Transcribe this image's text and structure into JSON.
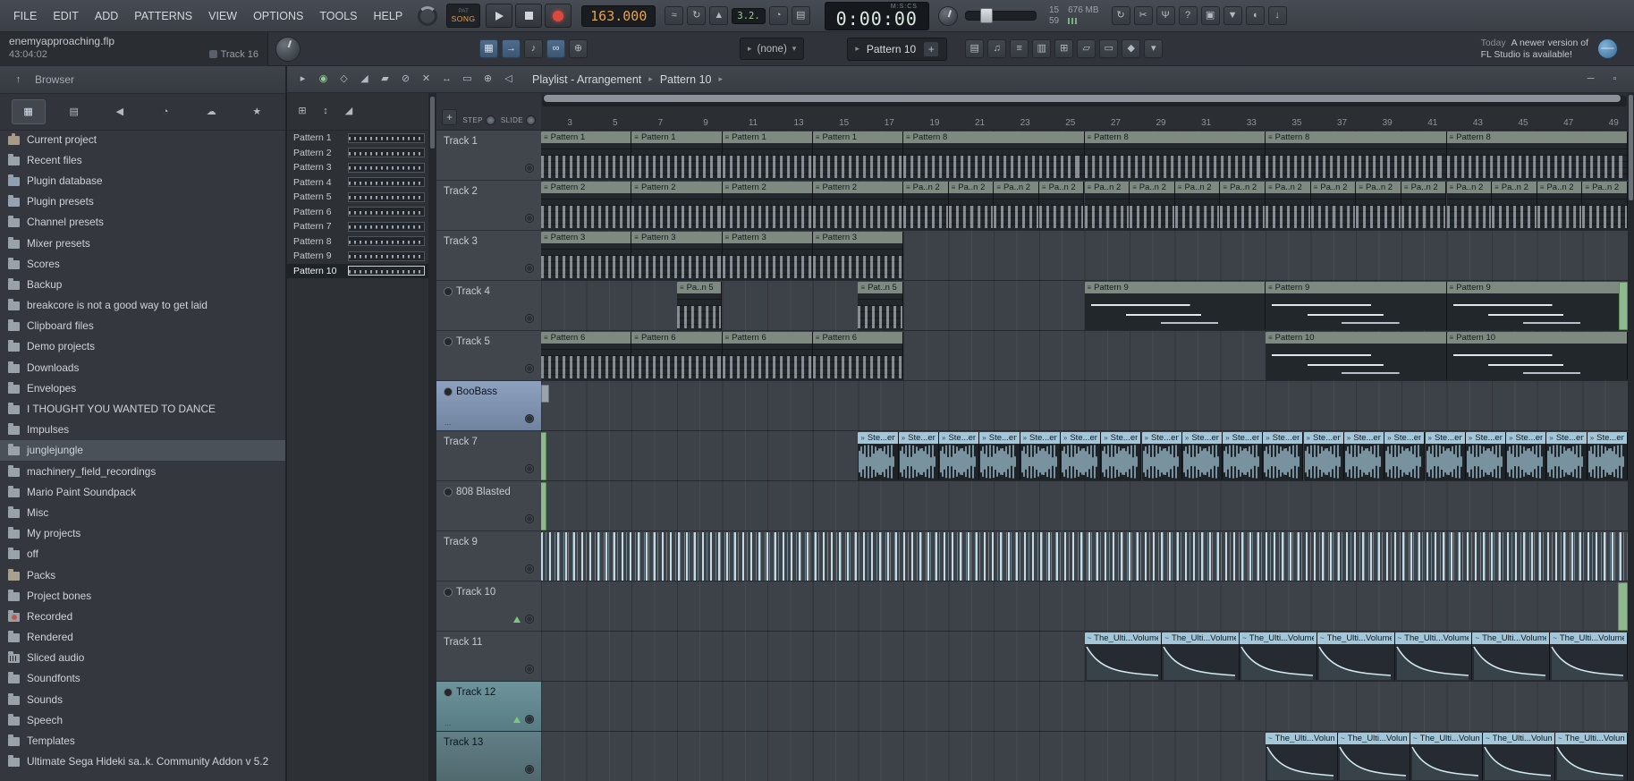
{
  "menubar": {
    "items": [
      "FILE",
      "EDIT",
      "ADD",
      "PATTERNS",
      "VIEW",
      "OPTIONS",
      "TOOLS",
      "HELP"
    ]
  },
  "transport": {
    "mode_top": "PAT",
    "mode_label": "SONG",
    "tempo": "163.000",
    "aux": "3.2.",
    "time": "0:00:00",
    "time_units": "M:S:CS",
    "stat_count": "15",
    "stat_memory": "676 MB",
    "stat_cpu": "59"
  },
  "project_panel": {
    "filename": "enemyapproaching.flp",
    "elapsed": "43:04:02",
    "track_hint": "Track 16"
  },
  "toolbar": {
    "picker_value": "(none)",
    "pattern_value": "Pattern 10",
    "pattern_add": "+",
    "notification_day": "Today",
    "notification_line1": "A newer version of",
    "notification_line2": "FL Studio is available!"
  },
  "browser": {
    "title": "Browser",
    "items": [
      {
        "label": "Current project",
        "icon": "case"
      },
      {
        "label": "Recent files",
        "icon": "folder"
      },
      {
        "label": "Plugin database",
        "icon": "db"
      },
      {
        "label": "Plugin presets",
        "icon": "plug"
      },
      {
        "label": "Channel presets",
        "icon": "folder"
      },
      {
        "label": "Mixer presets",
        "icon": "folder"
      },
      {
        "label": "Scores",
        "icon": "folder"
      },
      {
        "label": "Backup",
        "icon": "folder"
      },
      {
        "label": "breakcore is not a good way to get laid",
        "icon": "folder"
      },
      {
        "label": "Clipboard files",
        "icon": "folder"
      },
      {
        "label": "Demo projects",
        "icon": "folder"
      },
      {
        "label": "Downloads",
        "icon": "folder"
      },
      {
        "label": "Envelopes",
        "icon": "folder"
      },
      {
        "label": "I THOUGHT YOU WANTED TO DANCE",
        "icon": "folder"
      },
      {
        "label": "Impulses",
        "icon": "folder"
      },
      {
        "label": "junglejungle",
        "icon": "folder",
        "selected": true
      },
      {
        "label": "machinery_field_recordings",
        "icon": "folder"
      },
      {
        "label": "Mario Paint Soundpack",
        "icon": "folder"
      },
      {
        "label": "Misc",
        "icon": "folder"
      },
      {
        "label": "My projects",
        "icon": "folder"
      },
      {
        "label": "off",
        "icon": "folder"
      },
      {
        "label": "Packs",
        "icon": "pack"
      },
      {
        "label": "Project bones",
        "icon": "folder"
      },
      {
        "label": "Recorded",
        "icon": "rec"
      },
      {
        "label": "Rendered",
        "icon": "folder"
      },
      {
        "label": "Sliced audio",
        "icon": "sliced"
      },
      {
        "label": "Soundfonts",
        "icon": "folder"
      },
      {
        "label": "Sounds",
        "icon": "folder"
      },
      {
        "label": "Speech",
        "icon": "folder"
      },
      {
        "label": "Templates",
        "icon": "folder"
      },
      {
        "label": "Ultimate Sega Hideki sa..k. Community Addon v 5.2",
        "icon": "folder"
      }
    ]
  },
  "pattern_list": {
    "items": [
      "Pattern 1",
      "Pattern 2",
      "Pattern 3",
      "Pattern 4",
      "Pattern 5",
      "Pattern 6",
      "Pattern 7",
      "Pattern 8",
      "Pattern 9",
      "Pattern 10"
    ],
    "selected_index": 9
  },
  "playlist": {
    "title": "Playlist - Arrangement",
    "crumb": "Pattern 10",
    "add_label": "+",
    "step_label": "STEP",
    "slide_label": "SLIDE",
    "first_bar": 2,
    "ruler_labels": [
      3,
      5,
      7,
      9,
      11,
      13,
      15,
      17,
      19,
      21,
      23,
      25,
      27,
      29,
      31,
      33,
      35,
      37,
      39,
      41,
      43,
      45,
      47,
      49
    ],
    "tracks": [
      {
        "name": "Track 1",
        "clips": [
          {
            "t": "p",
            "label": "Pattern 1",
            "s": 2,
            "l": 4
          },
          {
            "t": "p",
            "label": "Pattern 1",
            "s": 6,
            "l": 4
          },
          {
            "t": "p",
            "label": "Pattern 1",
            "s": 10,
            "l": 4
          },
          {
            "t": "p",
            "label": "Pattern 1",
            "s": 14,
            "l": 4
          },
          {
            "t": "p",
            "label": "Pattern 8",
            "s": 18,
            "l": 8
          },
          {
            "t": "p",
            "label": "Pattern 8",
            "s": 26,
            "l": 8
          },
          {
            "t": "p",
            "label": "Pattern 8",
            "s": 34,
            "l": 8
          },
          {
            "t": "p",
            "label": "Pattern 8",
            "s": 42,
            "l": 8
          }
        ]
      },
      {
        "name": "Track 2",
        "clips": [
          {
            "t": "p",
            "label": "Pattern 2",
            "s": 2,
            "l": 4
          },
          {
            "t": "p",
            "label": "Pattern 2",
            "s": 6,
            "l": 4
          },
          {
            "t": "p",
            "label": "Pattern 2",
            "s": 10,
            "l": 4
          },
          {
            "t": "p",
            "label": "Pattern 2",
            "s": 14,
            "l": 4
          },
          {
            "t": "p",
            "label": "Pa..n 2",
            "s": 18,
            "l": 2
          },
          {
            "t": "p",
            "label": "Pa..n 2",
            "s": 20,
            "l": 2
          },
          {
            "t": "p",
            "label": "Pa..n 2",
            "s": 22,
            "l": 2
          },
          {
            "t": "p",
            "label": "Pa..n 2",
            "s": 24,
            "l": 2
          },
          {
            "t": "p",
            "label": "Pa..n 2",
            "s": 26,
            "l": 2
          },
          {
            "t": "p",
            "label": "Pa..n 2",
            "s": 28,
            "l": 2
          },
          {
            "t": "p",
            "label": "Pa..n 2",
            "s": 30,
            "l": 2
          },
          {
            "t": "p",
            "label": "Pa..n 2",
            "s": 32,
            "l": 2
          },
          {
            "t": "p",
            "label": "Pa..n 2",
            "s": 34,
            "l": 2
          },
          {
            "t": "p",
            "label": "Pa..n 2",
            "s": 36,
            "l": 2
          },
          {
            "t": "p",
            "label": "Pa..n 2",
            "s": 38,
            "l": 2
          },
          {
            "t": "p",
            "label": "Pa..n 2",
            "s": 40,
            "l": 2
          },
          {
            "t": "p",
            "label": "Pa..n 2",
            "s": 42,
            "l": 2
          },
          {
            "t": "p",
            "label": "Pa..n 2",
            "s": 44,
            "l": 2
          },
          {
            "t": "p",
            "label": "Pa..n 2",
            "s": 46,
            "l": 2
          },
          {
            "t": "p",
            "label": "Pa..n 2",
            "s": 48,
            "l": 2
          }
        ]
      },
      {
        "name": "Track 3",
        "clips": [
          {
            "t": "p",
            "label": "Pattern 3",
            "s": 2,
            "l": 4
          },
          {
            "t": "p",
            "label": "Pattern 3",
            "s": 6,
            "l": 4
          },
          {
            "t": "p",
            "label": "Pattern 3",
            "s": 10,
            "l": 4
          },
          {
            "t": "p",
            "label": "Pattern 3",
            "s": 14,
            "l": 4
          }
        ]
      },
      {
        "name": "Track 4",
        "muted_icon": true,
        "clips": [
          {
            "t": "p",
            "label": "Pa..n 5",
            "s": 8,
            "l": 2
          },
          {
            "t": "p",
            "label": "Pat..n 5",
            "s": 16,
            "l": 2
          },
          {
            "t": "pb",
            "label": "Pattern 9",
            "s": 26,
            "l": 8
          },
          {
            "t": "pb",
            "label": "Pattern 9",
            "s": 34,
            "l": 8
          },
          {
            "t": "pb",
            "label": "Pattern 9",
            "s": 42,
            "l": 8
          },
          {
            "t": "sg",
            "s": 49.6,
            "l": 0.4
          }
        ]
      },
      {
        "name": "Track 5",
        "muted_icon": true,
        "clips": [
          {
            "t": "p",
            "label": "Pattern 6",
            "s": 2,
            "l": 4
          },
          {
            "t": "p",
            "label": "Pattern 6",
            "s": 6,
            "l": 4
          },
          {
            "t": "p",
            "label": "Pattern 6",
            "s": 10,
            "l": 4
          },
          {
            "t": "p",
            "label": "Pattern 6",
            "s": 14,
            "l": 4
          },
          {
            "t": "pb",
            "label": "Pattern 10",
            "s": 34,
            "l": 8
          },
          {
            "t": "pb",
            "label": "Pattern 10",
            "s": 42,
            "l": 8
          }
        ]
      },
      {
        "name": "BooBass",
        "muted_icon": true,
        "sel": "blue",
        "sub": "...",
        "clips": [
          {
            "t": "sb",
            "s": 2,
            "l": 0.35
          }
        ]
      },
      {
        "name": "Track 7",
        "clips": [
          {
            "t": "sg",
            "s": 1.85,
            "l": 0.4
          },
          {
            "t": "a",
            "label": "Ste...en",
            "s": 16,
            "l": 1.79
          },
          {
            "t": "a",
            "label": "Ste...en",
            "s": 17.79,
            "l": 1.79
          },
          {
            "t": "a",
            "label": "Ste...en",
            "s": 19.58,
            "l": 1.79
          },
          {
            "t": "a",
            "label": "Ste...en",
            "s": 21.37,
            "l": 1.79
          },
          {
            "t": "a",
            "label": "Ste...en",
            "s": 23.16,
            "l": 1.79
          },
          {
            "t": "a",
            "label": "Ste...en",
            "s": 24.95,
            "l": 1.79
          },
          {
            "t": "a",
            "label": "Ste...en",
            "s": 26.74,
            "l": 1.79
          },
          {
            "t": "a",
            "label": "Ste...en",
            "s": 28.53,
            "l": 1.79
          },
          {
            "t": "a",
            "label": "Ste...en",
            "s": 30.32,
            "l": 1.79
          },
          {
            "t": "a",
            "label": "Ste...en",
            "s": 32.11,
            "l": 1.79
          },
          {
            "t": "a",
            "label": "Ste...en",
            "s": 33.89,
            "l": 1.79
          },
          {
            "t": "a",
            "label": "Ste...en",
            "s": 35.68,
            "l": 1.79
          },
          {
            "t": "a",
            "label": "Ste...en",
            "s": 37.47,
            "l": 1.79
          },
          {
            "t": "a",
            "label": "Ste...en",
            "s": 39.26,
            "l": 1.79
          },
          {
            "t": "a",
            "label": "Ste...en",
            "s": 41.05,
            "l": 1.79
          },
          {
            "t": "a",
            "label": "Ste...en",
            "s": 42.84,
            "l": 1.79
          },
          {
            "t": "a",
            "label": "Ste...en",
            "s": 44.63,
            "l": 1.79
          },
          {
            "t": "a",
            "label": "Ste...en",
            "s": 46.42,
            "l": 1.79
          },
          {
            "t": "a",
            "label": "Ste...en",
            "s": 48.21,
            "l": 1.79
          }
        ]
      },
      {
        "name": "808 Blasted",
        "muted_icon": true,
        "clips": [
          {
            "t": "sg",
            "s": 1.85,
            "l": 0.4
          }
        ]
      },
      {
        "name": "Track 9",
        "clips": [
          {
            "t": "sl",
            "s": 2,
            "l": 48
          }
        ]
      },
      {
        "name": "Track 10",
        "muted_icon": true,
        "arm": "green",
        "clips": [
          {
            "t": "sg",
            "s": 49.55,
            "l": 0.45
          }
        ]
      },
      {
        "name": "Track 11",
        "clips": [
          {
            "t": "au",
            "label": "The_Ulti...Volume",
            "s": 26,
            "l": 3.43
          },
          {
            "t": "au",
            "label": "The_Ulti...Volume",
            "s": 29.43,
            "l": 3.43
          },
          {
            "t": "au",
            "label": "The_Ulti...Volume",
            "s": 32.86,
            "l": 3.43
          },
          {
            "t": "au",
            "label": "The_Ulti...Volume",
            "s": 36.29,
            "l": 3.43
          },
          {
            "t": "au",
            "label": "The_Ulti...Volume",
            "s": 39.71,
            "l": 3.43
          },
          {
            "t": "au",
            "label": "The_Ulti...Volume",
            "s": 43.14,
            "l": 3.43
          },
          {
            "t": "au",
            "label": "The_Ulti...Volume",
            "s": 46.57,
            "l": 3.43
          }
        ]
      },
      {
        "name": "Track 12",
        "muted_icon": true,
        "sel": "teal",
        "arm": "green",
        "sub": "...",
        "clips": []
      },
      {
        "name": "Track 13",
        "sel": "teal2",
        "clips": [
          {
            "t": "au",
            "label": "The_Ulti...Volume",
            "s": 34,
            "l": 3.2
          },
          {
            "t": "au",
            "label": "The_Ulti...Volume",
            "s": 37.2,
            "l": 3.2
          },
          {
            "t": "au",
            "label": "The_Ulti...Volume",
            "s": 40.4,
            "l": 3.2
          },
          {
            "t": "au",
            "label": "The_Ulti...Volume",
            "s": 43.6,
            "l": 3.2
          },
          {
            "t": "au",
            "label": "The_Ulti...Volume",
            "s": 46.8,
            "l": 3.2
          }
        ]
      }
    ]
  },
  "icons": {
    "topbar_toggles1": [
      "overdub",
      "loop-record",
      "metronome"
    ],
    "topbar_toggles2": [
      "countdown",
      "typing-keyboard"
    ],
    "topbar_right": [
      "sync",
      "cut",
      "mic",
      "help",
      "save",
      "export",
      "feedback",
      "download"
    ],
    "toolbar_left": [
      "playlist",
      "forward",
      "pianoroll",
      "link",
      "touch"
    ],
    "toolbar_windows": [
      "channel-rack",
      "piano-roll",
      "quantizer",
      "mixer",
      "plugin-picker",
      "notes",
      "keys",
      "tools",
      "cart"
    ],
    "playlist_toolbar": [
      "menu",
      "magnet",
      "clipperclip",
      "draw",
      "paint",
      "delete",
      "mute",
      "slip",
      "select",
      "zoom",
      "preview"
    ],
    "pattern_toolbar": [
      "grid",
      "move",
      "draw2"
    ],
    "browser_tabs": [
      "plugins",
      "files",
      "sounds",
      "history",
      "cloud",
      "favorites"
    ],
    "window_buttons": [
      "minimize",
      "maximize"
    ]
  }
}
